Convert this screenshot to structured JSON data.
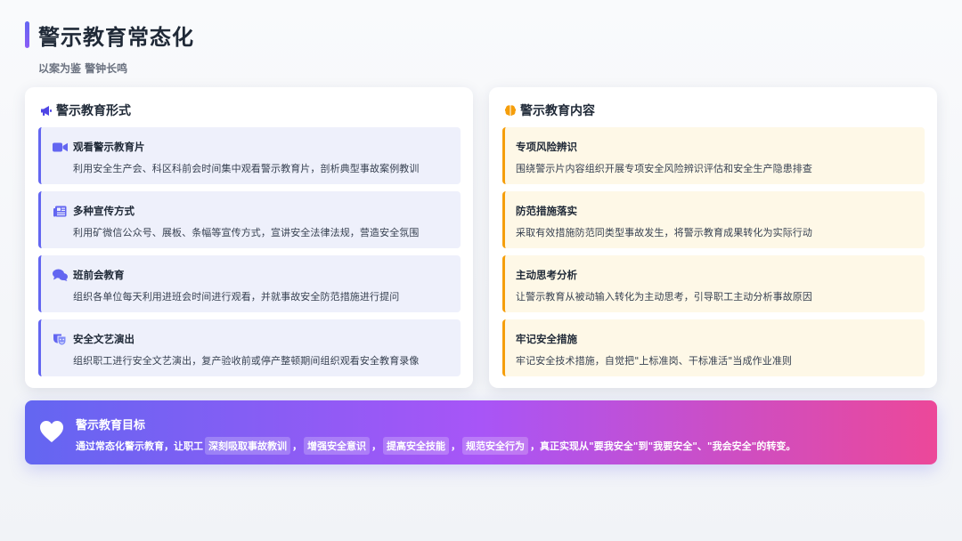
{
  "page": {
    "title": "警示教育常态化",
    "subtitle": "以案为鉴 警钟长鸣"
  },
  "left_card": {
    "icon": "megaphone-icon",
    "title": "警示教育形式",
    "items": [
      {
        "icon": "video-camera-icon",
        "title": "观看警示教育片",
        "desc": "利用安全生产会、科区科前会时间集中观看警示教育片，剖析典型事故案例教训"
      },
      {
        "icon": "newspaper-icon",
        "title": "多种宣传方式",
        "desc": "利用矿微信公众号、展板、条幅等宣传方式，宣讲安全法律法规，营造安全氛围"
      },
      {
        "icon": "chat-bubbles-icon",
        "title": "班前会教育",
        "desc": "组织各单位每天利用进班会时间进行观看，并就事故安全防范措施进行提问"
      },
      {
        "icon": "theater-masks-icon",
        "title": "安全文艺演出",
        "desc": "组织职工进行安全文艺演出，复产验收前或停产整顿期间组织观看安全教育录像"
      }
    ]
  },
  "right_card": {
    "icon": "brain-icon",
    "title": "警示教育内容",
    "items": [
      {
        "title": "专项风险辨识",
        "desc": "围绕警示片内容组织开展专项安全风险辨识评估和安全生产隐患排查"
      },
      {
        "title": "防范措施落实",
        "desc": "采取有效措施防范同类型事故发生，将警示教育成果转化为实际行动"
      },
      {
        "title": "主动思考分析",
        "desc": "让警示教育从被动输入转化为主动思考，引导职工主动分析事故原因"
      },
      {
        "title": "牢记安全措施",
        "desc": "牢记安全技术措施，自觉把\"上标准岗、干标准活\"当成作业准则"
      }
    ]
  },
  "goal": {
    "icon": "heart-icon",
    "title": "警示教育目标",
    "prefix": "通过常态化警示教育，让职工",
    "highlights": [
      "深刻吸取事故教训",
      "增强安全意识",
      "提高安全技能",
      "规范安全行为"
    ],
    "separator": "，",
    "suffix": "，真正实现从\"要我安全\"到\"我要安全\"、\"我会安全\"的转变。"
  },
  "colors": {
    "accent_indigo": "#6366f1",
    "accent_amber": "#f59e0b",
    "gradient_start": "#6366f1",
    "gradient_mid": "#a855f7",
    "gradient_end": "#ec4899"
  }
}
